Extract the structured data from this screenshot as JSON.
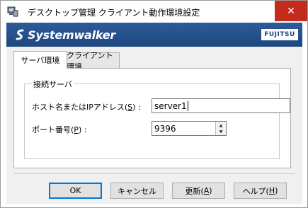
{
  "window": {
    "title": "デスクトップ管理 クライアント動作環境設定",
    "close_label": "✕"
  },
  "banner": {
    "product": "Systemwalker",
    "vendor": "FUJITSU"
  },
  "tabs": [
    {
      "label": "サーバ環境",
      "active": true
    },
    {
      "label": "クライアント環境",
      "active": false
    }
  ],
  "group": {
    "title": "接続サーバ",
    "host": {
      "label_prefix": "ホスト名またはIPアドレス(",
      "mnemonic": "S",
      "label_suffix": ") :",
      "value": "server1"
    },
    "port": {
      "label_prefix": "ポート番号(",
      "mnemonic": "P",
      "label_suffix": ") :",
      "value": "9396"
    }
  },
  "buttons": {
    "ok": "OK",
    "cancel": "キャンセル",
    "update": {
      "prefix": "更新(",
      "mnemonic": "A",
      "suffix": ")"
    },
    "help": {
      "prefix": "ヘルプ(",
      "mnemonic": "H",
      "suffix": ")"
    }
  },
  "colors": {
    "banner": "#1f4780",
    "close": "#c42b1c",
    "default_button_border": "#0078d7"
  }
}
